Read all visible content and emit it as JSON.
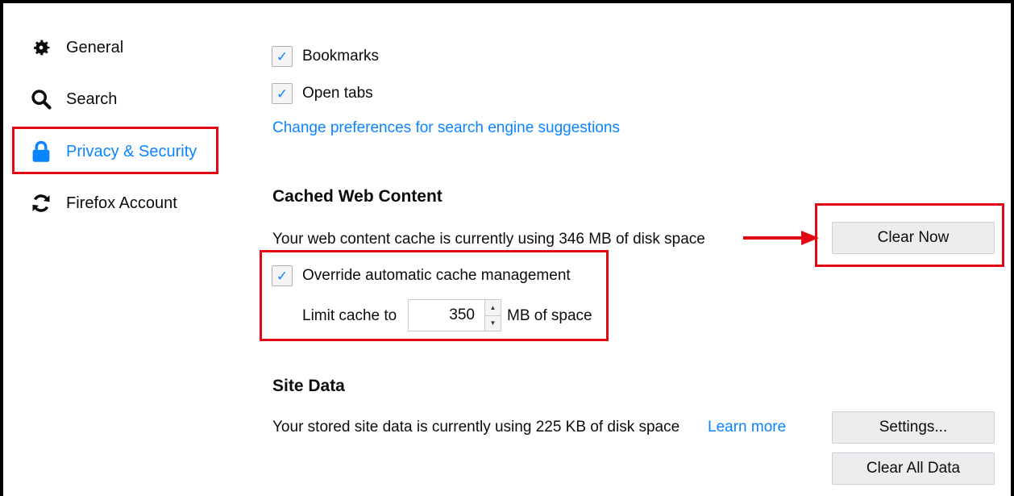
{
  "sidebar": {
    "items": [
      {
        "label": "General",
        "icon": "gear-icon"
      },
      {
        "label": "Search",
        "icon": "search-icon"
      },
      {
        "label": "Privacy & Security",
        "icon": "lock-icon",
        "selected": true
      },
      {
        "label": "Firefox Account",
        "icon": "sync-icon"
      }
    ]
  },
  "suggestions": {
    "bookmarks_label": "Bookmarks",
    "open_tabs_label": "Open tabs",
    "change_prefs_link": "Change preferences for search engine suggestions"
  },
  "cache": {
    "heading": "Cached Web Content",
    "usage_text": "Your web content cache is currently using 346 MB of disk space",
    "clear_now_label": "Clear Now",
    "override_label": "Override automatic cache management",
    "override_checked": true,
    "limit_label": "Limit cache to",
    "limit_value": "350",
    "limit_unit": "MB of space"
  },
  "site_data": {
    "heading": "Site Data",
    "usage_text": "Your stored site data is currently using 225 KB of disk space",
    "learn_more_link": "Learn more",
    "settings_label": "Settings...",
    "clear_all_label": "Clear All Data"
  },
  "colors": {
    "accent": "#0a84ff",
    "annotation_red": "#e30613"
  }
}
